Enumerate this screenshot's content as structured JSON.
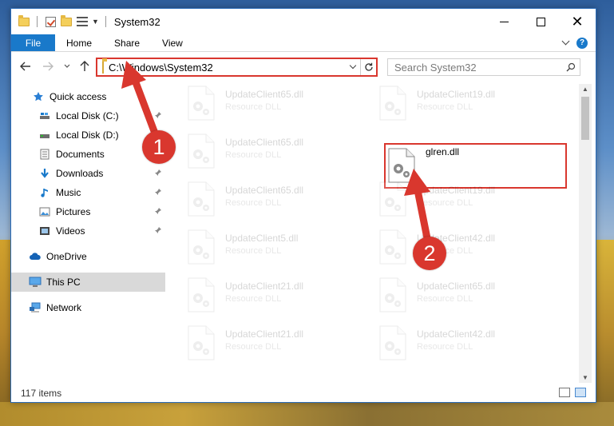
{
  "window": {
    "title": "System32",
    "close_glyph": "✕"
  },
  "ribbon": {
    "tabs": [
      {
        "label": "File"
      },
      {
        "label": "Home"
      },
      {
        "label": "Share"
      },
      {
        "label": "View"
      }
    ],
    "help_label": "?"
  },
  "address": {
    "path": "C:\\Windows\\System32",
    "search_placeholder": "Search System32"
  },
  "nav": {
    "items": [
      {
        "label": "Quick access",
        "icon": "star-icon"
      },
      {
        "label": "Local Disk (C:)",
        "icon": "drive-icon"
      },
      {
        "label": "Local Disk (D:)",
        "icon": "drive-icon"
      },
      {
        "label": "Documents",
        "icon": "documents-icon"
      },
      {
        "label": "Downloads",
        "icon": "download-icon"
      },
      {
        "label": "Music",
        "icon": "music-icon"
      },
      {
        "label": "Pictures",
        "icon": "pictures-icon"
      },
      {
        "label": "Videos",
        "icon": "videos-icon"
      },
      {
        "label": "OneDrive",
        "icon": "cloud-icon"
      },
      {
        "label": "This PC",
        "icon": "computer-icon"
      },
      {
        "label": "Network",
        "icon": "network-icon"
      }
    ]
  },
  "files": [
    {
      "name": "UpdateClient65.dll",
      "type": "Resource DLL"
    },
    {
      "name": "UpdateClient19.dll",
      "type": "Resource DLL"
    },
    {
      "name": "UpdateClient65.dll",
      "type": "Resource DLL"
    },
    {
      "name": "glren.dll",
      "type": ""
    },
    {
      "name": "UpdateClient65.dll",
      "type": "Resource DLL"
    },
    {
      "name": "UpdateClient19.dll",
      "type": "Resource DLL"
    },
    {
      "name": "UpdateClient5.dll",
      "type": "Resource DLL"
    },
    {
      "name": "UpdateClient42.dll",
      "type": "Resource DLL"
    },
    {
      "name": "UpdateClient21.dll",
      "type": "Resource DLL"
    },
    {
      "name": "UpdateClient65.dll",
      "type": "Resource DLL"
    },
    {
      "name": "UpdateClient21.dll",
      "type": "Resource DLL"
    },
    {
      "name": "UpdateClient42.dll",
      "type": "Resource DLL"
    }
  ],
  "status": {
    "item_count": "117 items"
  },
  "annotations": {
    "callout_1": "1",
    "callout_2": "2",
    "accent_color": "#d9372e"
  },
  "colors": {
    "file_tab": "#1979ca",
    "selection": "#d9d9d9"
  }
}
